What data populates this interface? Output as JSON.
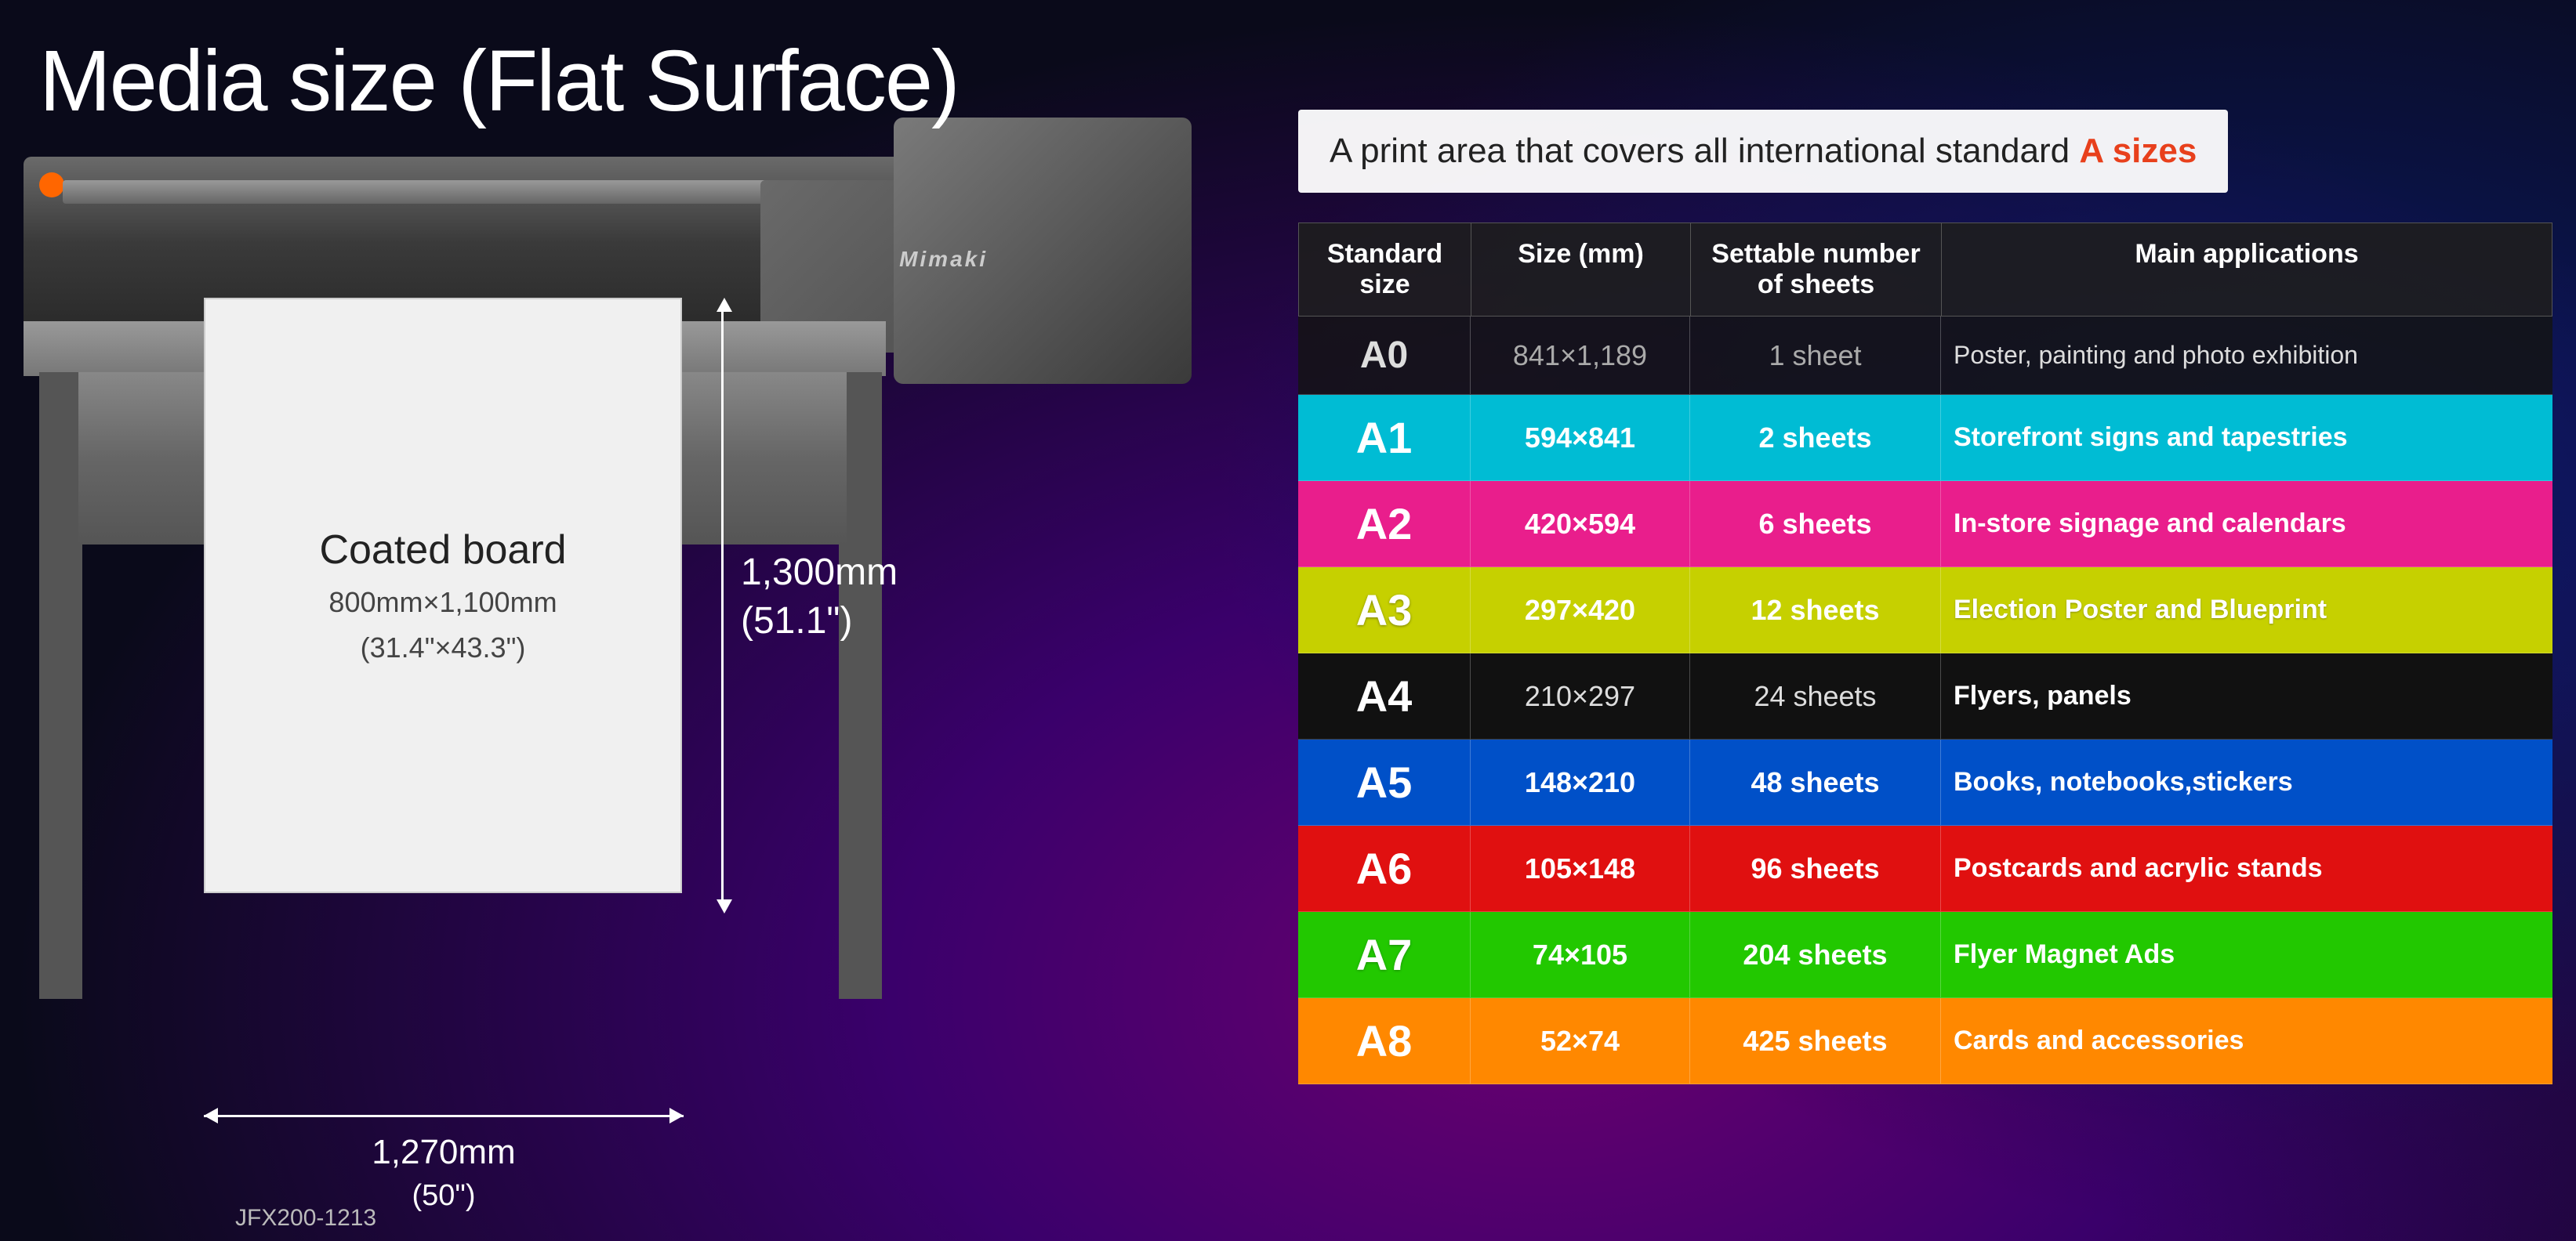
{
  "page": {
    "title": "Media size (Flat Surface)"
  },
  "info_box": {
    "text_before": "A print area that covers all international standard ",
    "accent": "A sizes",
    "text_after": ""
  },
  "table": {
    "headers": {
      "standard_size": "Standard size",
      "size_mm": "Size (mm)",
      "settable_sheets": "Settable number of sheets",
      "main_applications": "Main applications"
    },
    "rows": [
      {
        "id": "a0",
        "standard": "A0",
        "size": "841×1,189",
        "sheets": "1 sheet",
        "application": "Poster, painting and photo exhibition",
        "row_class": "row-a0"
      },
      {
        "id": "a1",
        "standard": "A1",
        "size": "594×841",
        "sheets": "2 sheets",
        "application": "Storefront signs and tapestries",
        "row_class": "row-a1"
      },
      {
        "id": "a2",
        "standard": "A2",
        "size": "420×594",
        "sheets": "6 sheets",
        "application": "In-store signage and calendars",
        "row_class": "row-a2"
      },
      {
        "id": "a3",
        "standard": "A3",
        "size": "297×420",
        "sheets": "12 sheets",
        "application": "Election Poster and Blueprint",
        "row_class": "row-a3"
      },
      {
        "id": "a4",
        "standard": "A4",
        "size": "210×297",
        "sheets": "24 sheets",
        "application": "Flyers, panels",
        "row_class": "row-a4"
      },
      {
        "id": "a5",
        "standard": "A5",
        "size": "148×210",
        "sheets": "48 sheets",
        "application": "Books, notebooks,stickers",
        "row_class": "row-a5"
      },
      {
        "id": "a6",
        "standard": "A6",
        "size": "105×148",
        "sheets": "96 sheets",
        "application": "Postcards and acrylic stands",
        "row_class": "row-a6"
      },
      {
        "id": "a7",
        "standard": "A7",
        "size": "74×105",
        "sheets": "204 sheets",
        "application": "Flyer Magnet Ads",
        "row_class": "row-a7"
      },
      {
        "id": "a8",
        "standard": "A8",
        "size": "52×74",
        "sheets": "425 sheets",
        "application": "Cards and accessories",
        "row_class": "row-a8"
      }
    ]
  },
  "coated_board": {
    "title": "Coated board",
    "dims_metric": "800mm×1,100mm",
    "dims_imperial": "(31.4\"×43.3\")"
  },
  "dimensions": {
    "height_label": "1,300mm",
    "height_label2": "(51.1\")",
    "width_label": "←  1,270mm  →",
    "width_label2": "(50\")"
  },
  "model": {
    "name": "JFX200-1213",
    "logo": "Mimaki"
  }
}
